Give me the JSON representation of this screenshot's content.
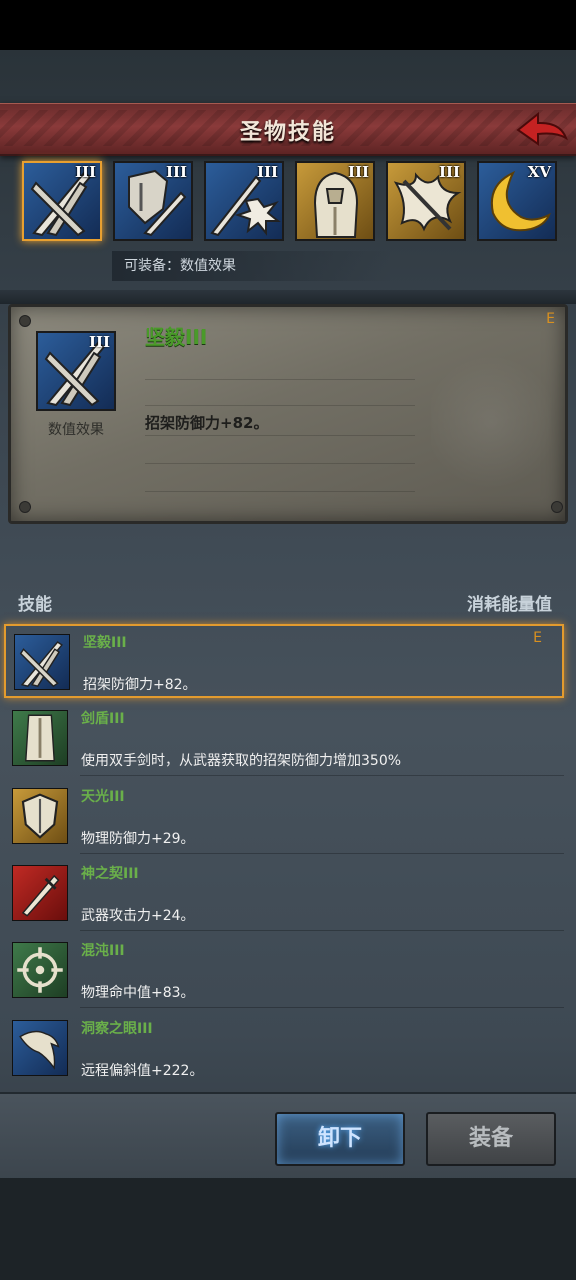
{
  "header": {
    "title": "圣物技能",
    "back_icon": "back-arrow-icon"
  },
  "relics": [
    {
      "icon": "crossed-swords-icon",
      "tier": "III",
      "frame": "blue",
      "selected": true
    },
    {
      "icon": "shield-sword-icon",
      "tier": "III",
      "frame": "blue",
      "selected": false
    },
    {
      "icon": "spear-burst-icon",
      "tier": "III",
      "frame": "blue",
      "selected": false
    },
    {
      "icon": "armored-knight-icon",
      "tier": "III",
      "frame": "gold",
      "selected": false
    },
    {
      "icon": "flaming-sword-icon",
      "tier": "III",
      "frame": "gold",
      "selected": false
    },
    {
      "icon": "crescent-moon-icon",
      "tier": "XV",
      "frame": "blue",
      "selected": false
    }
  ],
  "equippable_label": "可装备：数值效果",
  "detail": {
    "name": "坚毅III",
    "tier": "III",
    "caption": "数值效果",
    "description": "招架防御力+82。",
    "rank": "E"
  },
  "list_header": {
    "left": "技能",
    "right": "消耗能量值"
  },
  "skills": [
    {
      "name": "坚毅III",
      "desc": "招架防御力+82。",
      "rank": "E",
      "icon": "crossed-swords-icon",
      "selected": true
    },
    {
      "name": "剑盾III",
      "desc": "使用双手剑时，从武器获取的招架防御力增加350%",
      "rank": "",
      "icon": "sword-cloak-icon",
      "selected": false
    },
    {
      "name": "天光III",
      "desc": "物理防御力+29。",
      "rank": "",
      "icon": "shield-icon",
      "selected": false
    },
    {
      "name": "神之契III",
      "desc": "武器攻击力+24。",
      "rank": "",
      "icon": "red-sword-icon",
      "selected": false
    },
    {
      "name": "混沌III",
      "desc": "物理命中值+83。",
      "rank": "",
      "icon": "crosshair-icon",
      "selected": false
    },
    {
      "name": "洞察之眼III",
      "desc": "远程偏斜值+222。",
      "rank": "",
      "icon": "hawk-icon",
      "selected": false
    }
  ],
  "buttons": {
    "unequip": "卸下",
    "equip": "装备"
  },
  "colors": {
    "accent_orange": "#e39b2e",
    "skill_name_green": "#6ab04a",
    "title_red": "#8a3a3a"
  }
}
